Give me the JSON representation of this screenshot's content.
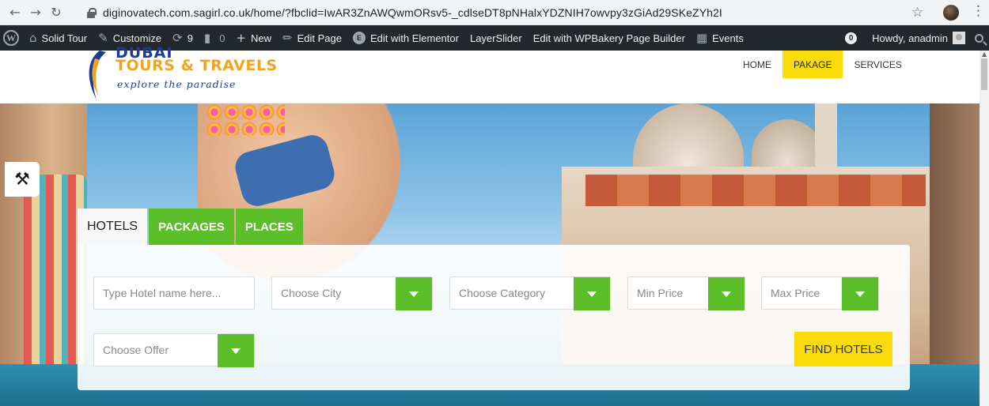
{
  "browser": {
    "back_icon": "arrow-left-icon",
    "forward_icon": "arrow-right-icon",
    "reload_icon": "reload-icon",
    "url": "diginovatech.com.sagirl.co.uk/home/?fbclid=IwAR3ZnAWQwmORsv5-_cdlseDT8pNHalxYDZNIH7owvpy3zGiAd29SKeZYh2I"
  },
  "adminbar": {
    "site_name": "Solid Tour",
    "customize": "Customize",
    "updates_count": "9",
    "comments_count": "0",
    "new": "New",
    "edit_page": "Edit Page",
    "edit_elementor": "Edit with Elementor",
    "layerslider": "LayerSlider",
    "edit_wpbakery": "Edit with WPBakery Page Builder",
    "events": "Events",
    "notifications": "0",
    "howdy": "Howdy, anadmin"
  },
  "logo": {
    "title": "TOURS & TRAVELS",
    "tagline": "explore the paradise",
    "cut_text": "DUBAI"
  },
  "menu": [
    {
      "label": "HOME",
      "active": false
    },
    {
      "label": "PAKAGE",
      "active": true
    },
    {
      "label": "SERVICES",
      "active": false
    }
  ],
  "search": {
    "tabs": [
      {
        "label": "HOTELS",
        "active": true
      },
      {
        "label": "PACKAGES",
        "active": false
      },
      {
        "label": "PLACES",
        "active": false
      }
    ],
    "hotel_name_placeholder": "Type Hotel name here...",
    "city": "Choose City",
    "category": "Choose Category",
    "min_price": "Min Price",
    "max_price": "Max Price",
    "offer": "Choose Offer",
    "find_button": "FIND HOTELS"
  },
  "colors": {
    "accent_green": "#5cbf2a",
    "accent_yellow": "#fbdc0b",
    "adminbar_bg": "#23282d"
  }
}
